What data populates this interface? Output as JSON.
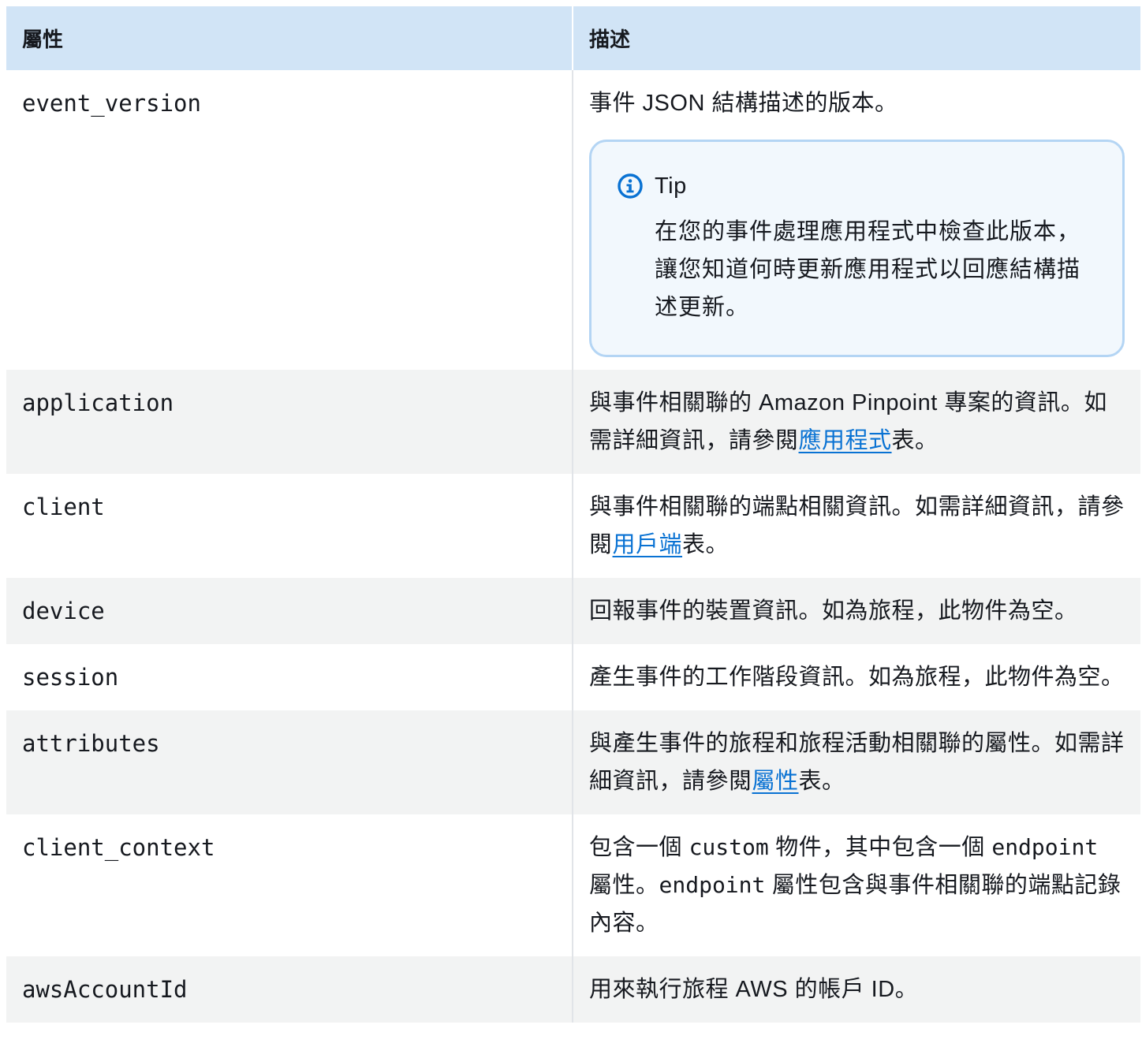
{
  "header": {
    "col1": "屬性",
    "col2": "描述"
  },
  "rows": [
    {
      "attr": "event_version",
      "desc": "事件 JSON 結構描述的版本。",
      "tip": {
        "title": "Tip",
        "body": "在您的事件處理應用程式中檢查此版本，讓您知道何時更新應用程式以回應結構描述更新。",
        "icon": "info-icon"
      }
    },
    {
      "attr": "application",
      "desc_before": "與事件相關聯的 Amazon Pinpoint 專案的資訊。如需詳細資訊，請參閱",
      "link": "應用程式",
      "desc_after": "表。"
    },
    {
      "attr": "client",
      "desc_before": "與事件相關聯的端點相關資訊。如需詳細資訊，請參閱",
      "link": "用戶端",
      "desc_after": "表。"
    },
    {
      "attr": "device",
      "desc": "回報事件的裝置資訊。如為旅程，此物件為空。"
    },
    {
      "attr": "session",
      "desc": "產生事件的工作階段資訊。如為旅程，此物件為空。"
    },
    {
      "attr": "attributes",
      "desc_before": "與產生事件的旅程和旅程活動相關聯的屬性。如需詳細資訊，請參閱",
      "link": "屬性",
      "desc_after": "表。"
    },
    {
      "attr": "client_context",
      "desc_p1": "包含一個 ",
      "code1": "custom",
      "desc_p2": " 物件，其中包含一個 ",
      "code2": "endpoint",
      "desc_p3": " 屬性。",
      "code3": "endpoint",
      "desc_p4": " 屬性包含與事件相關聯的端點記錄內容。"
    },
    {
      "attr": "awsAccountId",
      "desc": "用來執行旅程 AWS 的帳戶 ID。"
    }
  ],
  "colors": {
    "header_bg": "#d1e4f6",
    "stripe_bg": "#f2f3f3",
    "link": "#0972d3",
    "tip_border": "#b4d5f4",
    "tip_bg": "#f2f8fd"
  }
}
